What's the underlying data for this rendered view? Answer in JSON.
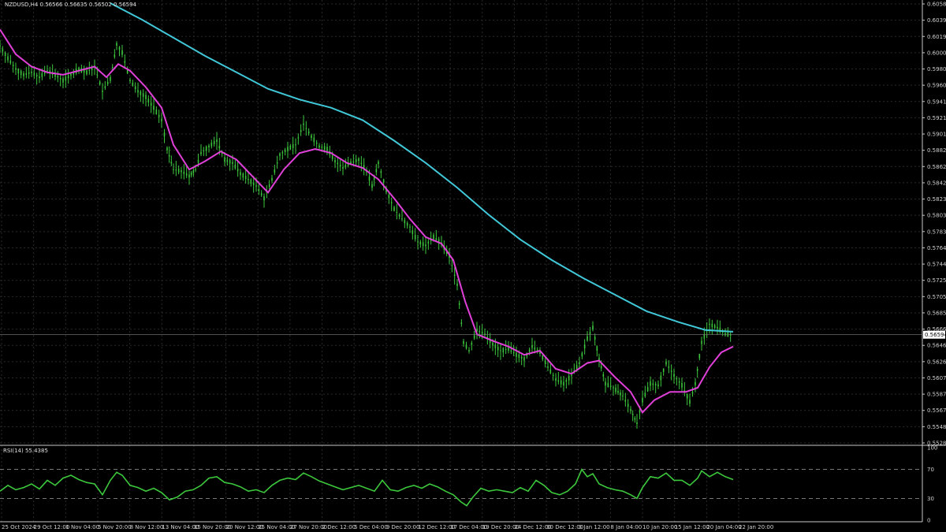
{
  "window": {
    "title": "NZDUSD,H4 0.56566 0.56635 0.56502 0.56594"
  },
  "colors": {
    "background": "#000000",
    "grid": "#2a2a2a",
    "candle": "#3cc83c",
    "ma_fast": "#e040d8",
    "ma_slow": "#40c8d8",
    "rsi": "#3cc83c",
    "axis_text": "#d0d0d0",
    "price_tag_bg": "#ffffff"
  },
  "chart_data": [
    {
      "type": "candlestick",
      "symbol": "NZDUSD",
      "timeframe": "H4",
      "ohlc_last": {
        "open": 0.56566,
        "high": 0.56635,
        "low": 0.56502,
        "close": 0.56594
      },
      "current_price_label": "0.56594",
      "grid": true,
      "ylim": [
        0.5528,
        0.6062
      ],
      "y_ticks": [
        "0.60585",
        "0.60390",
        "0.60195",
        "0.60000",
        "0.59800",
        "0.59605",
        "0.59410",
        "0.59210",
        "0.59015",
        "0.58820",
        "0.58625",
        "0.58425",
        "0.58230",
        "0.58035",
        "0.57835",
        "0.57640",
        "0.57445",
        "0.57250",
        "0.57050",
        "0.56855",
        "0.56660",
        "0.56465",
        "0.56265",
        "0.56070",
        "0.55875",
        "0.55675",
        "0.55480",
        "0.55285"
      ],
      "x_ticks": [
        "25 Oct 2024",
        "29 Oct 12:00",
        "1 Nov 04:00",
        "5 Nov 20:00",
        "8 Nov 12:00",
        "13 Nov 04:00",
        "15 Nov 20:00",
        "20 Nov 12:00",
        "25 Nov 04:00",
        "27 Nov 20:00",
        "2 Dec 12:00",
        "5 Dec 04:00",
        "9 Dec 20:00",
        "12 Dec 12:00",
        "17 Dec 04:00",
        "19 Dec 20:00",
        "24 Dec 12:00",
        "30 Dec 12:00",
        "3 Jan 12:00",
        "8 Jan 04:00",
        "10 Jan 20:00",
        "15 Jan 12:00",
        "20 Jan 04:00",
        "22 Jan 20:00"
      ],
      "price_path": [
        [
          0,
          0.601
        ],
        [
          10,
          0.5995
        ],
        [
          20,
          0.5982
        ],
        [
          30,
          0.5975
        ],
        [
          40,
          0.5978
        ],
        [
          50,
          0.5972
        ],
        [
          60,
          0.598
        ],
        [
          70,
          0.5975
        ],
        [
          80,
          0.5968
        ],
        [
          90,
          0.5975
        ],
        [
          100,
          0.5982
        ],
        [
          110,
          0.5978
        ],
        [
          120,
          0.5985
        ],
        [
          130,
          0.5955
        ],
        [
          140,
          0.597
        ],
        [
          148,
          0.6012
        ],
        [
          155,
          0.6002
        ],
        [
          165,
          0.5968
        ],
        [
          175,
          0.5955
        ],
        [
          185,
          0.5948
        ],
        [
          195,
          0.5935
        ],
        [
          205,
          0.592
        ],
        [
          212,
          0.5885
        ],
        [
          220,
          0.586
        ],
        [
          230,
          0.5858
        ],
        [
          240,
          0.5852
        ],
        [
          248,
          0.586
        ],
        [
          255,
          0.588
        ],
        [
          265,
          0.5888
        ],
        [
          275,
          0.5895
        ],
        [
          285,
          0.5872
        ],
        [
          295,
          0.5868
        ],
        [
          305,
          0.5855
        ],
        [
          315,
          0.5848
        ],
        [
          325,
          0.584
        ],
        [
          335,
          0.5825
        ],
        [
          345,
          0.5848
        ],
        [
          355,
          0.5878
        ],
        [
          365,
          0.5885
        ],
        [
          375,
          0.589
        ],
        [
          385,
          0.5915
        ],
        [
          395,
          0.59
        ],
        [
          405,
          0.5888
        ],
        [
          415,
          0.5885
        ],
        [
          425,
          0.587
        ],
        [
          435,
          0.5862
        ],
        [
          445,
          0.5868
        ],
        [
          455,
          0.5872
        ],
        [
          465,
          0.5858
        ],
        [
          472,
          0.584
        ],
        [
          480,
          0.5868
        ],
        [
          490,
          0.5835
        ],
        [
          500,
          0.5812
        ],
        [
          510,
          0.58
        ],
        [
          520,
          0.579
        ],
        [
          530,
          0.5772
        ],
        [
          540,
          0.5768
        ],
        [
          550,
          0.5778
        ],
        [
          560,
          0.577
        ],
        [
          570,
          0.5755
        ],
        [
          580,
          0.572
        ],
        [
          588,
          0.565
        ],
        [
          595,
          0.564
        ],
        [
          605,
          0.5665
        ],
        [
          615,
          0.566
        ],
        [
          625,
          0.5648
        ],
        [
          635,
          0.564
        ],
        [
          645,
          0.5642
        ],
        [
          655,
          0.5635
        ],
        [
          665,
          0.563
        ],
        [
          675,
          0.5645
        ],
        [
          685,
          0.5638
        ],
        [
          695,
          0.562
        ],
        [
          705,
          0.5605
        ],
        [
          715,
          0.56
        ],
        [
          725,
          0.561
        ],
        [
          735,
          0.5625
        ],
        [
          745,
          0.5655
        ],
        [
          752,
          0.5668
        ],
        [
          760,
          0.563
        ],
        [
          768,
          0.56
        ],
        [
          778,
          0.5595
        ],
        [
          790,
          0.5585
        ],
        [
          800,
          0.5568
        ],
        [
          808,
          0.5552
        ],
        [
          815,
          0.558
        ],
        [
          825,
          0.56
        ],
        [
          835,
          0.5598
        ],
        [
          845,
          0.5625
        ],
        [
          855,
          0.561
        ],
        [
          865,
          0.5598
        ],
        [
          875,
          0.5578
        ],
        [
          882,
          0.56
        ],
        [
          890,
          0.565
        ],
        [
          900,
          0.5672
        ],
        [
          910,
          0.5668
        ],
        [
          920,
          0.566
        ],
        [
          930,
          0.5659
        ]
      ],
      "ma_fast": [
        [
          0,
          0.603
        ],
        [
          20,
          0.6
        ],
        [
          40,
          0.5985
        ],
        [
          60,
          0.5978
        ],
        [
          80,
          0.5975
        ],
        [
          100,
          0.598
        ],
        [
          120,
          0.5985
        ],
        [
          135,
          0.5972
        ],
        [
          150,
          0.5988
        ],
        [
          165,
          0.598
        ],
        [
          185,
          0.596
        ],
        [
          205,
          0.5935
        ],
        [
          220,
          0.589
        ],
        [
          240,
          0.586
        ],
        [
          260,
          0.587
        ],
        [
          280,
          0.5882
        ],
        [
          300,
          0.5872
        ],
        [
          320,
          0.5852
        ],
        [
          340,
          0.5832
        ],
        [
          360,
          0.586
        ],
        [
          380,
          0.588
        ],
        [
          400,
          0.5885
        ],
        [
          420,
          0.588
        ],
        [
          440,
          0.5868
        ],
        [
          460,
          0.5862
        ],
        [
          480,
          0.5848
        ],
        [
          500,
          0.5825
        ],
        [
          520,
          0.58
        ],
        [
          540,
          0.5778
        ],
        [
          560,
          0.577
        ],
        [
          575,
          0.575
        ],
        [
          590,
          0.57
        ],
        [
          605,
          0.566
        ],
        [
          625,
          0.5652
        ],
        [
          645,
          0.5645
        ],
        [
          665,
          0.5635
        ],
        [
          685,
          0.564
        ],
        [
          705,
          0.5618
        ],
        [
          725,
          0.5612
        ],
        [
          745,
          0.5625
        ],
        [
          760,
          0.5628
        ],
        [
          780,
          0.5608
        ],
        [
          800,
          0.559
        ],
        [
          815,
          0.5565
        ],
        [
          830,
          0.558
        ],
        [
          850,
          0.559
        ],
        [
          870,
          0.559
        ],
        [
          885,
          0.5595
        ],
        [
          900,
          0.562
        ],
        [
          915,
          0.5638
        ],
        [
          930,
          0.5645
        ]
      ],
      "ma_slow": [
        [
          140,
          0.6062
        ],
        [
          180,
          0.6042
        ],
        [
          220,
          0.602
        ],
        [
          260,
          0.5998
        ],
        [
          300,
          0.5978
        ],
        [
          340,
          0.5958
        ],
        [
          380,
          0.5945
        ],
        [
          420,
          0.5935
        ],
        [
          460,
          0.592
        ],
        [
          500,
          0.5895
        ],
        [
          540,
          0.5868
        ],
        [
          580,
          0.5838
        ],
        [
          620,
          0.5805
        ],
        [
          660,
          0.5775
        ],
        [
          700,
          0.575
        ],
        [
          740,
          0.5728
        ],
        [
          780,
          0.5708
        ],
        [
          820,
          0.5688
        ],
        [
          860,
          0.5675
        ],
        [
          895,
          0.5665
        ],
        [
          930,
          0.5663
        ]
      ]
    },
    {
      "type": "line",
      "name": "RSI(14) 55.4385",
      "ylim": [
        0,
        100
      ],
      "y_ticks": [
        "100",
        "70",
        "30",
        "0"
      ],
      "levels": [
        70,
        30
      ],
      "values": [
        [
          0,
          40
        ],
        [
          10,
          48
        ],
        [
          20,
          42
        ],
        [
          30,
          45
        ],
        [
          40,
          50
        ],
        [
          50,
          43
        ],
        [
          60,
          55
        ],
        [
          70,
          48
        ],
        [
          80,
          58
        ],
        [
          90,
          62
        ],
        [
          100,
          56
        ],
        [
          110,
          52
        ],
        [
          120,
          50
        ],
        [
          130,
          35
        ],
        [
          140,
          55
        ],
        [
          148,
          66
        ],
        [
          155,
          62
        ],
        [
          165,
          48
        ],
        [
          175,
          45
        ],
        [
          185,
          40
        ],
        [
          195,
          44
        ],
        [
          205,
          38
        ],
        [
          215,
          28
        ],
        [
          225,
          32
        ],
        [
          235,
          40
        ],
        [
          245,
          42
        ],
        [
          255,
          48
        ],
        [
          265,
          58
        ],
        [
          275,
          60
        ],
        [
          285,
          52
        ],
        [
          295,
          50
        ],
        [
          305,
          46
        ],
        [
          315,
          40
        ],
        [
          325,
          42
        ],
        [
          335,
          38
        ],
        [
          345,
          48
        ],
        [
          355,
          55
        ],
        [
          365,
          58
        ],
        [
          375,
          56
        ],
        [
          385,
          65
        ],
        [
          395,
          60
        ],
        [
          405,
          54
        ],
        [
          415,
          50
        ],
        [
          425,
          46
        ],
        [
          435,
          42
        ],
        [
          445,
          45
        ],
        [
          455,
          48
        ],
        [
          465,
          44
        ],
        [
          475,
          40
        ],
        [
          485,
          55
        ],
        [
          495,
          42
        ],
        [
          505,
          40
        ],
        [
          515,
          45
        ],
        [
          525,
          48
        ],
        [
          535,
          44
        ],
        [
          545,
          50
        ],
        [
          555,
          46
        ],
        [
          565,
          40
        ],
        [
          575,
          35
        ],
        [
          585,
          25
        ],
        [
          592,
          20
        ],
        [
          600,
          32
        ],
        [
          610,
          44
        ],
        [
          620,
          40
        ],
        [
          630,
          42
        ],
        [
          640,
          40
        ],
        [
          650,
          38
        ],
        [
          660,
          45
        ],
        [
          670,
          40
        ],
        [
          680,
          55
        ],
        [
          690,
          48
        ],
        [
          700,
          38
        ],
        [
          710,
          35
        ],
        [
          720,
          40
        ],
        [
          730,
          50
        ],
        [
          738,
          70
        ],
        [
          745,
          60
        ],
        [
          752,
          64
        ],
        [
          760,
          50
        ],
        [
          770,
          45
        ],
        [
          780,
          42
        ],
        [
          790,
          40
        ],
        [
          800,
          35
        ],
        [
          808,
          30
        ],
        [
          815,
          45
        ],
        [
          825,
          60
        ],
        [
          835,
          58
        ],
        [
          845,
          65
        ],
        [
          855,
          55
        ],
        [
          865,
          55
        ],
        [
          875,
          48
        ],
        [
          885,
          58
        ],
        [
          890,
          68
        ],
        [
          900,
          60
        ],
        [
          910,
          66
        ],
        [
          920,
          60
        ],
        [
          930,
          56
        ]
      ]
    }
  ]
}
